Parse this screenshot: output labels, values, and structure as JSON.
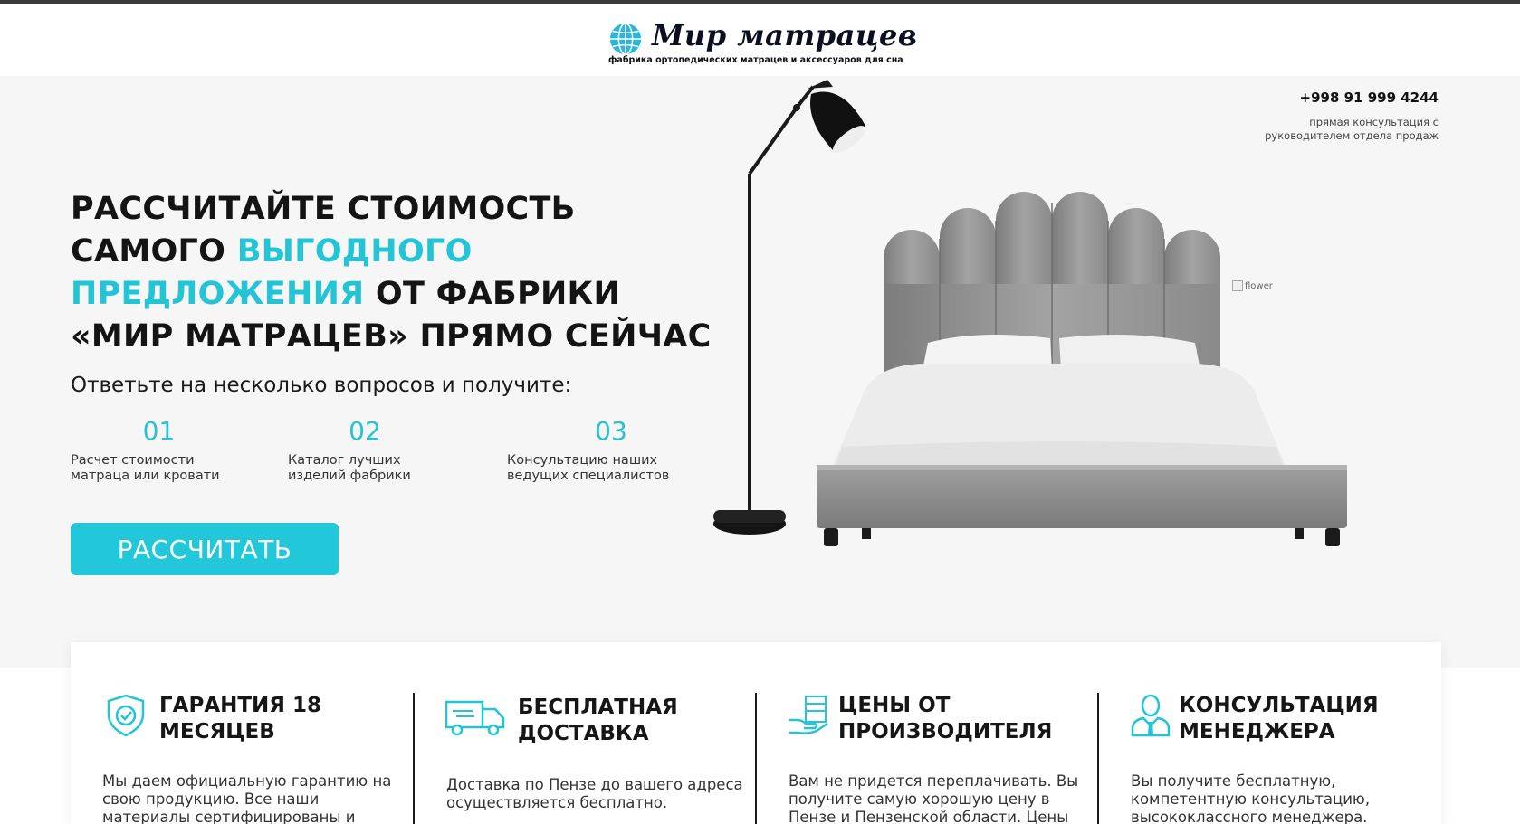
{
  "header": {
    "brand": "Мир матрацев",
    "tagline": "фабрика ортопедических матрацев и аксессуаров для сна"
  },
  "hero": {
    "phone": "+998 91 999 4244",
    "consult_note": "прямая консультация с\nруководителем отдела продаж",
    "headline_part1": "Рассчитайте стоимость самого ",
    "headline_highlight": "выгодного предложения",
    "headline_part2": " от фабрики «Мир матрацев» прямо сейчас",
    "subtitle": "Ответьте на несколько вопросов и получите:",
    "benefits": [
      {
        "num": "01",
        "text": "Расчет стоимости\nматраца или кровати"
      },
      {
        "num": "02",
        "text": "Каталог лучших\nизделий фабрики"
      },
      {
        "num": "03",
        "text": "Консультацию наших\nведущих специалистов"
      }
    ],
    "cta_label": "РАССЧИТАТЬ",
    "broken_image_alt": "flower"
  },
  "features": [
    {
      "icon": "shield-check-icon",
      "title": "Гарантия 18\nмесяцев",
      "desc": "Мы даем официальную гарантию на свою продукцию. Все наши материалы сертифицированы и"
    },
    {
      "icon": "delivery-truck-icon",
      "title": "Бесплатная\nдоставка",
      "desc": "Доставка по Пензе до вашего адреса осуществляется бесплатно."
    },
    {
      "icon": "hand-money-icon",
      "title": "Цены от\nпроизводителя",
      "desc": "Вам не придется переплачивать. Вы получите самую хорошую цену в Пензе и Пензенской области. Цены"
    },
    {
      "icon": "manager-icon",
      "title": "Консультация\nменеджера",
      "desc": "Вы получите бесплатную, компетентную консультацию, высококлассного менеджера."
    }
  ],
  "colors": {
    "accent": "#22c4d6",
    "hero_bg": "#f6f6f6"
  }
}
